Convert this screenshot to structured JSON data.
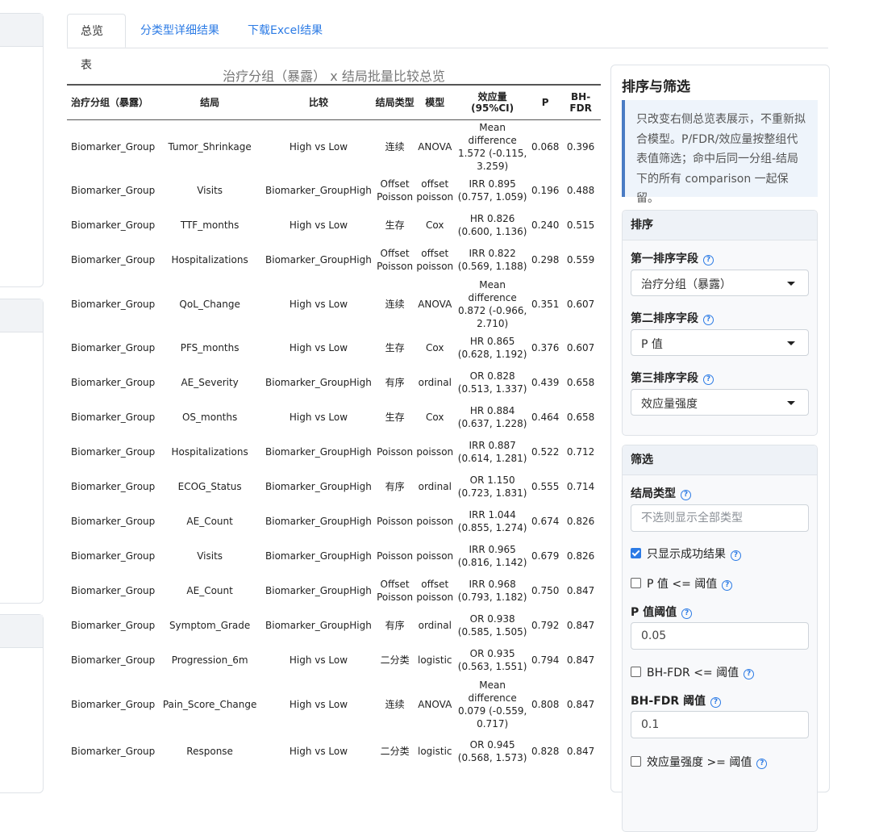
{
  "tabs": [
    "总览表",
    "分类型详细结果",
    "下载Excel结果"
  ],
  "table": {
    "title": "治疗分组（暴露） x 结局批量比较总览",
    "headers": [
      "治疗分组（暴露）",
      "结局",
      "比较",
      "结局类型",
      "模型",
      "效应量 (95%CI)",
      "P",
      "BH-FDR"
    ],
    "rows": [
      [
        "Biomarker_Group",
        "Tumor_Shrinkage",
        "High vs Low",
        "连续",
        "ANOVA",
        "Mean difference 1.572 (-0.115, 3.259)",
        "0.068",
        "0.396"
      ],
      [
        "Biomarker_Group",
        "Visits",
        "Biomarker_GroupHigh",
        "Offset Poisson",
        "offset poisson",
        "IRR 0.895 (0.757, 1.059)",
        "0.196",
        "0.488"
      ],
      [
        "Biomarker_Group",
        "TTF_months",
        "High vs Low",
        "生存",
        "Cox",
        "HR 0.826 (0.600, 1.136)",
        "0.240",
        "0.515"
      ],
      [
        "Biomarker_Group",
        "Hospitalizations",
        "Biomarker_GroupHigh",
        "Offset Poisson",
        "offset poisson",
        "IRR 0.822 (0.569, 1.188)",
        "0.298",
        "0.559"
      ],
      [
        "Biomarker_Group",
        "QoL_Change",
        "High vs Low",
        "连续",
        "ANOVA",
        "Mean difference 0.872 (-0.966, 2.710)",
        "0.351",
        "0.607"
      ],
      [
        "Biomarker_Group",
        "PFS_months",
        "High vs Low",
        "生存",
        "Cox",
        "HR 0.865 (0.628, 1.192)",
        "0.376",
        "0.607"
      ],
      [
        "Biomarker_Group",
        "AE_Severity",
        "Biomarker_GroupHigh",
        "有序",
        "ordinal",
        "OR 0.828 (0.513, 1.337)",
        "0.439",
        "0.658"
      ],
      [
        "Biomarker_Group",
        "OS_months",
        "High vs Low",
        "生存",
        "Cox",
        "HR 0.884 (0.637, 1.228)",
        "0.464",
        "0.658"
      ],
      [
        "Biomarker_Group",
        "Hospitalizations",
        "Biomarker_GroupHigh",
        "Poisson",
        "poisson",
        "IRR 0.887 (0.614, 1.281)",
        "0.522",
        "0.712"
      ],
      [
        "Biomarker_Group",
        "ECOG_Status",
        "Biomarker_GroupHigh",
        "有序",
        "ordinal",
        "OR 1.150 (0.723, 1.831)",
        "0.555",
        "0.714"
      ],
      [
        "Biomarker_Group",
        "AE_Count",
        "Biomarker_GroupHigh",
        "Poisson",
        "poisson",
        "IRR 1.044 (0.855, 1.274)",
        "0.674",
        "0.826"
      ],
      [
        "Biomarker_Group",
        "Visits",
        "Biomarker_GroupHigh",
        "Poisson",
        "poisson",
        "IRR 0.965 (0.816, 1.142)",
        "0.679",
        "0.826"
      ],
      [
        "Biomarker_Group",
        "AE_Count",
        "Biomarker_GroupHigh",
        "Offset Poisson",
        "offset poisson",
        "IRR 0.968 (0.793, 1.182)",
        "0.750",
        "0.847"
      ],
      [
        "Biomarker_Group",
        "Symptom_Grade",
        "Biomarker_GroupHigh",
        "有序",
        "ordinal",
        "OR 0.938 (0.585, 1.505)",
        "0.792",
        "0.847"
      ],
      [
        "Biomarker_Group",
        "Progression_6m",
        "High vs Low",
        "二分类",
        "logistic",
        "OR 0.935 (0.563, 1.551)",
        "0.794",
        "0.847"
      ],
      [
        "Biomarker_Group",
        "Pain_Score_Change",
        "High vs Low",
        "连续",
        "ANOVA",
        "Mean difference 0.079 (-0.559, 0.717)",
        "0.808",
        "0.847"
      ],
      [
        "Biomarker_Group",
        "Response",
        "High vs Low",
        "二分类",
        "logistic",
        "OR 0.945 (0.568, 1.573)",
        "0.828",
        "0.847"
      ]
    ]
  },
  "sidebar": {
    "title": "排序与筛选",
    "info": "只改变右侧总览表展示，不重新拟合模型。P/FDR/效应量按整组代表值筛选；命中后同一分组-结局下的所有 comparison 一起保留。",
    "sort": {
      "header": "排序",
      "field1_label": "第一排序字段",
      "field1_value": "治疗分组（暴露）",
      "field2_label": "第二排序字段",
      "field2_value": "P 值",
      "field3_label": "第三排序字段",
      "field3_value": "效应量强度"
    },
    "filter": {
      "header": "筛选",
      "outcome_type_label": "结局类型",
      "outcome_type_placeholder": "不选则显示全部类型",
      "success_only_label": "只显示成功结果",
      "success_only_checked": true,
      "p_filter_label": "P 值 <= 阈值",
      "p_filter_checked": false,
      "p_threshold_label": "P 值阈值",
      "p_threshold_value": "0.05",
      "fdr_filter_label": "BH-FDR <= 阈值",
      "fdr_filter_checked": false,
      "fdr_threshold_label": "BH-FDR 阈值",
      "fdr_threshold_value": "0.1",
      "effect_filter_label": "效应量强度 >= 阈值",
      "effect_filter_checked": false
    }
  }
}
